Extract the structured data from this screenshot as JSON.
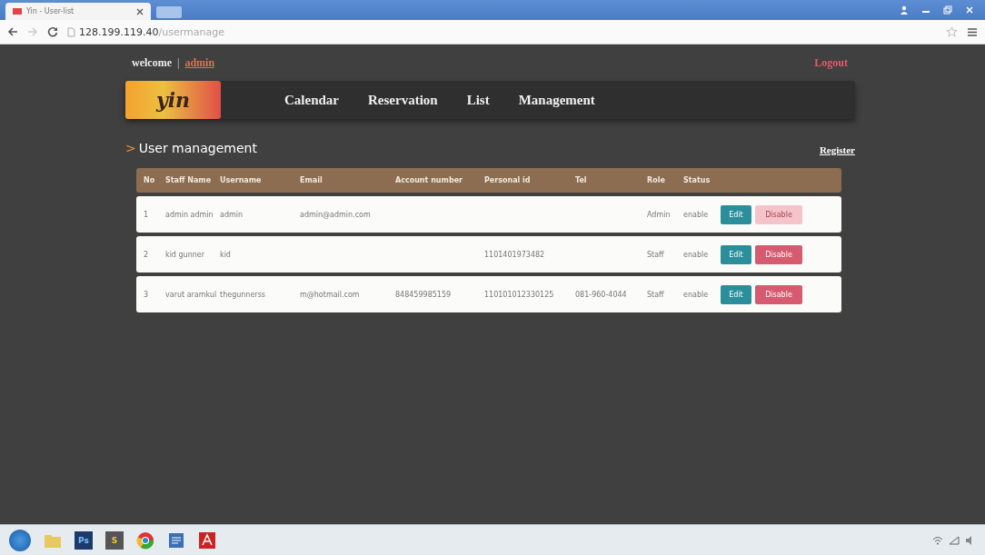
{
  "browser": {
    "tab_title": "Yin - User-list",
    "url_host": "128.199.119.40",
    "url_path": "/usermanage"
  },
  "topbar": {
    "welcome": "welcome",
    "separator": "|",
    "user": "admin",
    "logout": "Logout"
  },
  "nav": {
    "logo": "yin",
    "items": [
      {
        "label": "Calendar",
        "selected": false
      },
      {
        "label": "Reservation",
        "selected": false
      },
      {
        "label": "List",
        "selected": false
      },
      {
        "label": "Management",
        "selected": false
      }
    ]
  },
  "section": {
    "marker": ">",
    "title": "User management",
    "register": "Register"
  },
  "table": {
    "columns": [
      "No",
      "Staff Name",
      "Username",
      "Email",
      "Account number",
      "Personal id",
      "Tel",
      "Role",
      "Status"
    ],
    "rows": [
      {
        "cells": [
          "1",
          "admin admin",
          "admin",
          "admin@admin.com",
          "",
          "",
          "",
          "Admin",
          "enable"
        ],
        "edit": "Edit",
        "disable": "Disable",
        "disable_disabled": true
      },
      {
        "cells": [
          "2",
          "kid gunner",
          "kid",
          "",
          "",
          "1101401973482",
          "",
          "Staff",
          "enable"
        ],
        "edit": "Edit",
        "disable": "Disable",
        "disable_disabled": false
      },
      {
        "cells": [
          "3",
          "varut aramkul",
          "thegunnerss",
          "m@hotmail.com",
          "848459985159",
          "110101012330125",
          "081-960-4044",
          "Staff",
          "enable"
        ],
        "edit": "Edit",
        "disable": "Disable",
        "disable_disabled": false
      }
    ]
  },
  "taskbar": {
    "apps": [
      {
        "kind": "folder"
      },
      {
        "kind": "text",
        "label": "Ps"
      },
      {
        "kind": "text",
        "label": "S"
      },
      {
        "kind": "chrome"
      },
      {
        "kind": "doc"
      },
      {
        "kind": "pdf"
      }
    ]
  }
}
